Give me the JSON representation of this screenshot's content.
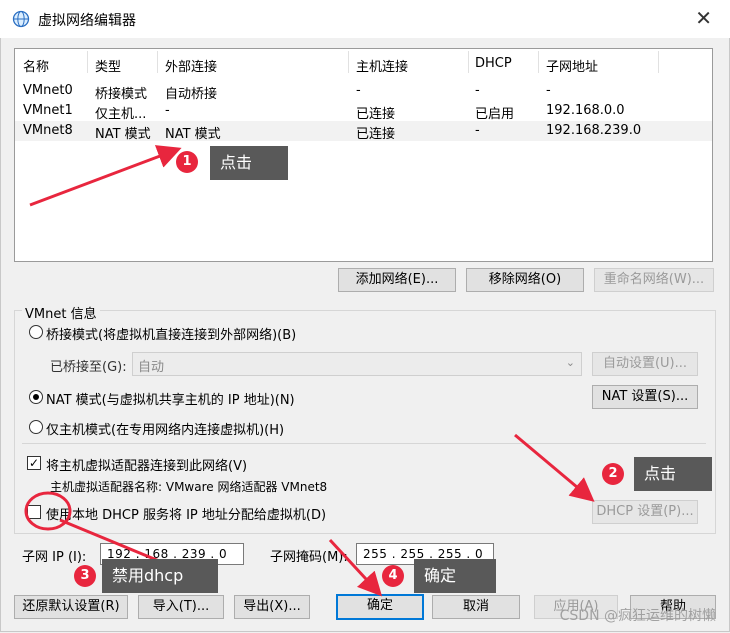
{
  "window": {
    "title": "虚拟网络编辑器",
    "icon": "globe-icon"
  },
  "table": {
    "headers": [
      "名称",
      "类型",
      "外部连接",
      "主机连接",
      "DHCP",
      "子网地址"
    ],
    "rows": [
      {
        "name": "VMnet0",
        "type": "桥接模式",
        "external": "自动桥接",
        "host": "-",
        "dhcp": "-",
        "subnet": "-"
      },
      {
        "name": "VMnet1",
        "type": "仅主机...",
        "external": "-",
        "host": "已连接",
        "dhcp": "已启用",
        "subnet": "192.168.0.0"
      },
      {
        "name": "VMnet8",
        "type": "NAT 模式",
        "external": "NAT 模式",
        "host": "已连接",
        "dhcp": "-",
        "subnet": "192.168.239.0"
      }
    ],
    "selected_row": 2
  },
  "list_buttons": {
    "add": "添加网络(E)...",
    "remove": "移除网络(O)",
    "rename": "重命名网络(W)..."
  },
  "vmnet_info": {
    "group_title": "VMnet 信息",
    "bridge_mode": "桥接模式(将虚拟机直接连接到外部网络)(B)",
    "bridged_to_label": "已桥接至(G):",
    "bridged_to_value": "自动",
    "auto_settings": "自动设置(U)...",
    "nat_mode": "NAT 模式(与虚拟机共享主机的 IP 地址)(N)",
    "nat_settings": "NAT 设置(S)...",
    "host_only": "仅主机模式(在专用网络内连接虚拟机)(H)",
    "connect_adapter": "将主机虚拟适配器连接到此网络(V)",
    "adapter_name": "主机虚拟适配器名称: VMware 网络适配器 VMnet8",
    "use_dhcp": "使用本地 DHCP 服务将 IP 地址分配给虚拟机(D)",
    "dhcp_settings": "DHCP 设置(P)...",
    "subnet_ip_label": "子网 IP (I):",
    "subnet_ip": "192 . 168 . 239 . 0",
    "subnet_mask_label": "子网掩码(M):",
    "subnet_mask": "255 . 255 . 255 . 0",
    "selected_mode": "nat",
    "connect_adapter_checked": true,
    "use_dhcp_checked": false
  },
  "footer_buttons": {
    "restore": "还原默认设置(R)",
    "import": "导入(T)...",
    "export": "导出(X)...",
    "ok": "确定",
    "cancel": "取消",
    "apply": "应用(A)",
    "help": "帮助"
  },
  "annotations": [
    {
      "num": "1",
      "text": "点击"
    },
    {
      "num": "2",
      "text": "点击"
    },
    {
      "num": "3",
      "text": "禁用dhcp"
    },
    {
      "num": "4",
      "text": "确定"
    }
  ],
  "watermark": "CSDN @疯狂运维的树懒",
  "colors": {
    "accent": "#0078d7",
    "annotation_red": "#e8263e",
    "callout_bg": "#595959"
  }
}
